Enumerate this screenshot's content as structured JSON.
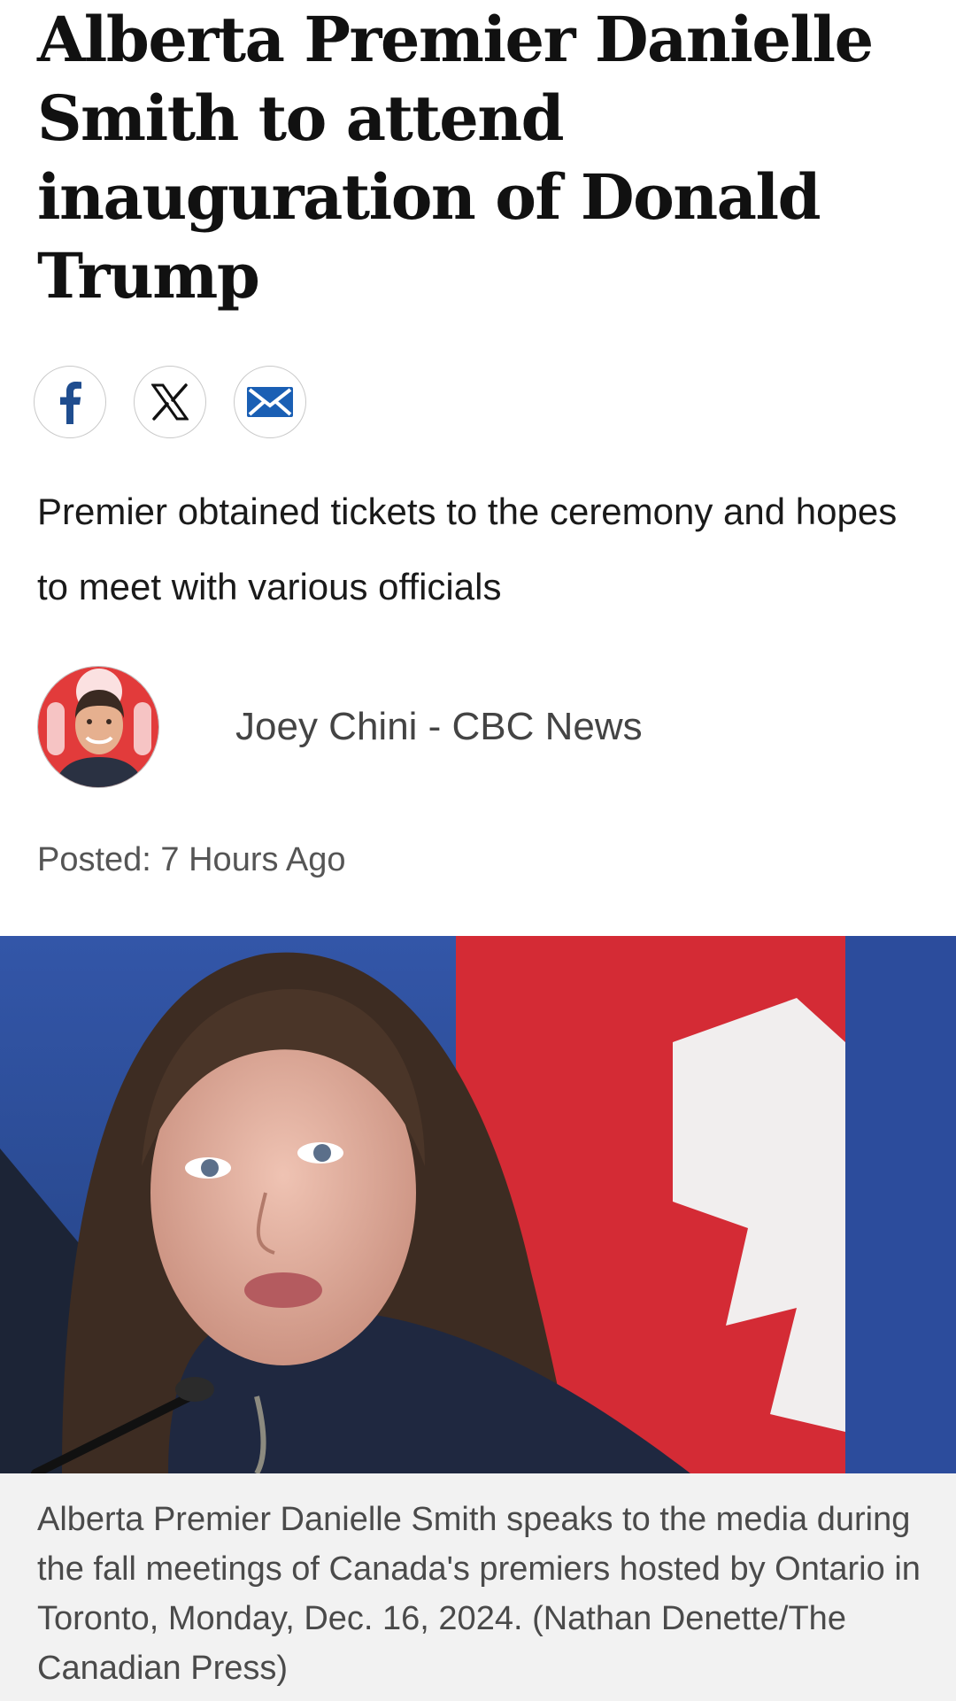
{
  "article": {
    "headline": "Alberta Premier Danielle Smith to attend inauguration of Donald Trump",
    "subheadline": "Premier obtained tickets to the ceremony and hopes to meet with various officials",
    "author": "Joey Chini - CBC News",
    "posted": "Posted: 7 Hours Ago",
    "caption": "Alberta Premier Danielle Smith speaks to the media during the fall meetings of Canada's premiers hosted by Ontario in Toronto, Monday, Dec. 16, 2024. (Nathan Denette/The Canadian Press)"
  },
  "share": {
    "facebook_icon": "facebook-icon",
    "x_icon": "x-icon",
    "email_icon": "email-icon"
  },
  "colors": {
    "facebook": "#1f4d8f",
    "email": "#1a5fb4",
    "flag_red": "#d42b35",
    "flag_blue_backdrop": "#2c4c9c",
    "caption_bg": "#f2f2f2"
  }
}
